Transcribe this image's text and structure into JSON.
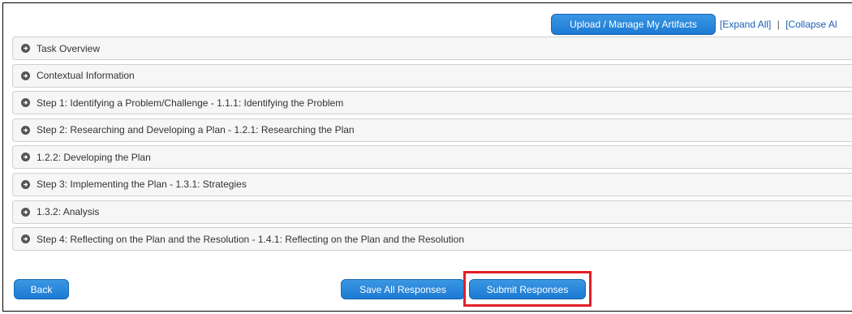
{
  "toolbar": {
    "upload_label": "Upload / Manage My Artifacts",
    "expand_all": "[Expand All]",
    "separator": "|",
    "collapse_all": "[Collapse Al"
  },
  "sections": [
    {
      "label": "Task Overview"
    },
    {
      "label": "Contextual Information"
    },
    {
      "label": "Step 1: Identifying a Problem/Challenge - 1.1.1: Identifying the Problem"
    },
    {
      "label": "Step 2: Researching and Developing a Plan - 1.2.1: Researching the Plan"
    },
    {
      "label": "1.2.2: Developing the Plan"
    },
    {
      "label": "Step 3: Implementing the Plan - 1.3.1: Strategies"
    },
    {
      "label": "1.3.2: Analysis"
    },
    {
      "label": "Step 4: Reflecting on the Plan and the Resolution - 1.4.1: Reflecting on the Plan and the Resolution"
    }
  ],
  "footer": {
    "back_label": "Back",
    "save_label": "Save All Responses",
    "submit_label": "Submit Responses"
  },
  "colors": {
    "button_blue": "#1c7ad3",
    "link_blue": "#1a5fb4",
    "highlight_red": "#e0202a"
  },
  "icons": {
    "section_toggle": "circle-arrow-right-icon"
  }
}
